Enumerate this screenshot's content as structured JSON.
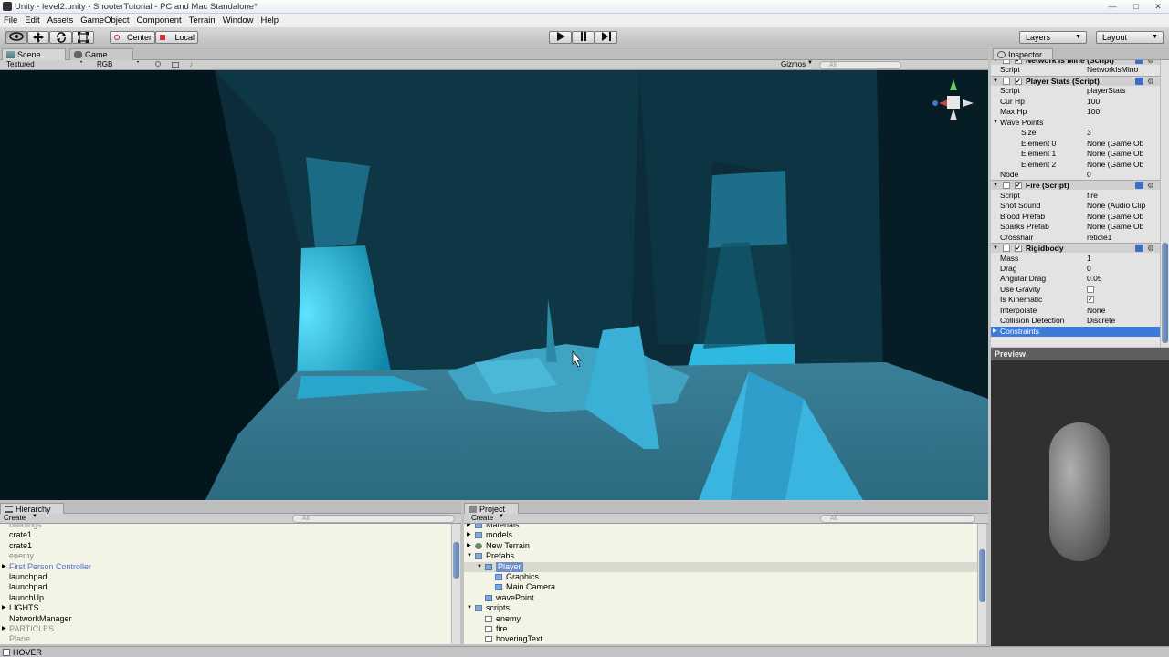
{
  "window": {
    "title": "Unity - level2.unity - ShooterTutorial - PC and Mac Standalone*"
  },
  "menu": [
    "File",
    "Edit",
    "Assets",
    "GameObject",
    "Component",
    "Terrain",
    "Window",
    "Help"
  ],
  "toolbar": {
    "center_label": "Center",
    "local_label": "Local",
    "layers_label": "Layers",
    "layout_label": "Layout"
  },
  "scene_tabs": {
    "scene": "Scene",
    "game": "Game"
  },
  "scene_bar": {
    "render_mode": "Textured",
    "color_mode": "RGB",
    "gizmos": "Gizmos",
    "search": "All"
  },
  "hierarchy": {
    "tab": "Hierarchy",
    "create": "Create",
    "search": "All",
    "items": [
      {
        "label": "buildings",
        "dim": true
      },
      {
        "label": "crate1"
      },
      {
        "label": "crate1"
      },
      {
        "label": "enemy",
        "dim": true
      },
      {
        "label": "First Person Controller",
        "blue": true,
        "expand": true
      },
      {
        "label": "launchpad"
      },
      {
        "label": "launchpad"
      },
      {
        "label": "launchUp"
      },
      {
        "label": "LIGHTS",
        "expand": true
      },
      {
        "label": "NetworkManager"
      },
      {
        "label": "PARTICLES",
        "dim": true,
        "expand": true
      },
      {
        "label": "Plane",
        "dim": true
      }
    ]
  },
  "project": {
    "tab": "Project",
    "create": "Create",
    "search": "All",
    "items": [
      {
        "label": "Materials",
        "indent": 1,
        "icon": "folder",
        "expand": "closed"
      },
      {
        "label": "models",
        "indent": 1,
        "icon": "folder",
        "expand": "closed"
      },
      {
        "label": "New Terrain",
        "indent": 1,
        "icon": "terrain",
        "expand": "closed"
      },
      {
        "label": "Prefabs",
        "indent": 1,
        "icon": "folder",
        "expand": "open"
      },
      {
        "label": "Player",
        "indent": 2,
        "icon": "prefab",
        "expand": "open",
        "selected": true
      },
      {
        "label": "Graphics",
        "indent": 3,
        "icon": "prefab"
      },
      {
        "label": "Main Camera",
        "indent": 3,
        "icon": "prefab"
      },
      {
        "label": "wavePoint",
        "indent": 2,
        "icon": "prefab"
      },
      {
        "label": "scripts",
        "indent": 1,
        "icon": "folder",
        "expand": "open"
      },
      {
        "label": "enemy",
        "indent": 2,
        "icon": "script"
      },
      {
        "label": "fire",
        "indent": 2,
        "icon": "script"
      },
      {
        "label": "hoveringText",
        "indent": 2,
        "icon": "script"
      }
    ]
  },
  "inspector": {
    "tab": "Inspector",
    "rows": [
      {
        "type": "comp",
        "label": "Network Is Mine (Script)"
      },
      {
        "label": "Script",
        "value": "NetworkIsMino"
      },
      {
        "type": "comp",
        "label": "Player Stats (Script)"
      },
      {
        "label": "Script",
        "value": "playerStats"
      },
      {
        "label": "Cur Hp",
        "value": "100"
      },
      {
        "label": "Max Hp",
        "value": "100"
      },
      {
        "label": "Wave Points",
        "expand": true
      },
      {
        "label": "Size",
        "value": "3",
        "indent": true
      },
      {
        "label": "Element 0",
        "value": "None (Game Ob",
        "indent": true
      },
      {
        "label": "Element 1",
        "value": "None (Game Ob",
        "indent": true
      },
      {
        "label": "Element 2",
        "value": "None (Game Ob",
        "indent": true
      },
      {
        "label": "Node",
        "value": "0"
      },
      {
        "type": "comp",
        "label": "Fire (Script)"
      },
      {
        "label": "Script",
        "value": "fire"
      },
      {
        "label": "Shot Sound",
        "value": "None (Audio Clip"
      },
      {
        "label": "Blood Prefab",
        "value": "None (Game Ob"
      },
      {
        "label": "Sparks Prefab",
        "value": "None (Game Ob"
      },
      {
        "label": "Crosshair",
        "value": "reticle1"
      },
      {
        "type": "comp",
        "label": "Rigidbody"
      },
      {
        "label": "Mass",
        "value": "1"
      },
      {
        "label": "Drag",
        "value": "0"
      },
      {
        "label": "Angular Drag",
        "value": "0.05"
      },
      {
        "label": "Use Gravity",
        "check": false
      },
      {
        "label": "Is Kinematic",
        "check": true
      },
      {
        "label": "Interpolate",
        "value": "None"
      },
      {
        "label": "Collision Detection",
        "value": "Discrete"
      },
      {
        "label": "Constraints",
        "selected": true
      }
    ]
  },
  "preview": {
    "title": "Preview"
  },
  "status": {
    "text": "HOVER"
  }
}
